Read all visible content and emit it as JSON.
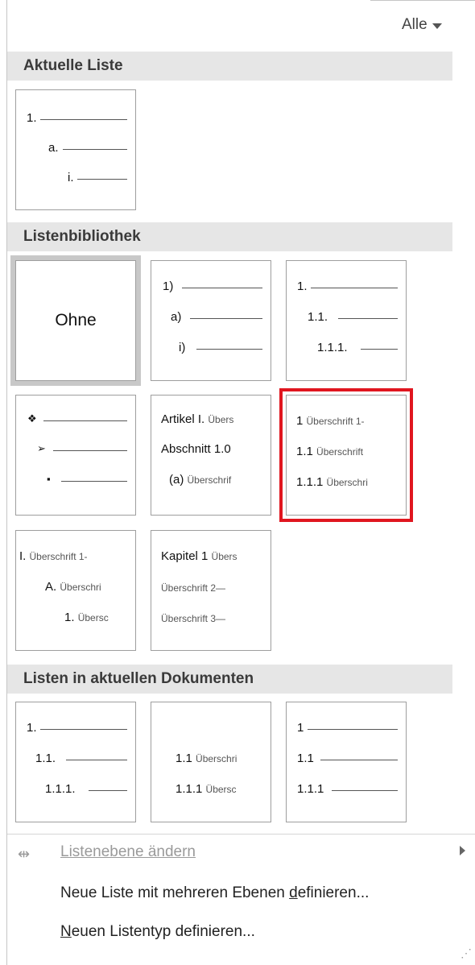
{
  "filter": {
    "label": "Alle"
  },
  "sections": {
    "current": "Aktuelle Liste",
    "library": "Listenbibliothek",
    "documents": "Listen in aktuellen Dokumenten"
  },
  "current_tile": {
    "l1": "1.",
    "l2": "a.",
    "l3": "i."
  },
  "library_tiles": {
    "none": "Ohne",
    "paren": {
      "l1": "1)",
      "l2": "a)",
      "l3": "i)"
    },
    "decimal": {
      "l1": "1.",
      "l2": "1.1.",
      "l3": "1.1.1."
    },
    "bullets": {
      "l1": "❖",
      "l2": "➢",
      "l3": "▪"
    },
    "article": {
      "l1a": "Artikel I.",
      "l1b": "Übers",
      "l2": "Abschnitt 1.0",
      "l3a": "(a)",
      "l3b": "Überschrif"
    },
    "heading_num": {
      "l1a": "1",
      "l1b": "Überschrift 1-",
      "l2a": "1.1",
      "l2b": "Überschrift",
      "l3a": "1.1.1",
      "l3b": "Überschri"
    },
    "roman": {
      "l1a": "I.",
      "l1b": "Überschrift 1-",
      "l2a": "A.",
      "l2b": "Überschri",
      "l3a": "1.",
      "l3b": "Übersc"
    },
    "kapitel": {
      "l1a": "Kapitel 1",
      "l1b": "Übers",
      "l2": "Überschrift 2—",
      "l3": "Überschrift 3—"
    }
  },
  "doc_tiles": {
    "a": {
      "l1": "1.",
      "l2": "1.1.",
      "l3": "1.1.1."
    },
    "b": {
      "l2a": "1.1",
      "l2b": "Überschri",
      "l3a": "1.1.1",
      "l3b": "Übersc"
    },
    "c": {
      "l1": "1",
      "l2": "1.1",
      "l3": "1.1.1"
    }
  },
  "menu": {
    "change_level": "Listenebene ändern",
    "define_multilevel": {
      "pre": "Neue Liste mit mehreren Ebenen ",
      "u": "d",
      "post": "efinieren..."
    },
    "define_style": {
      "u": "N",
      "post": "euen Listentyp definieren..."
    }
  },
  "icons": {
    "change_level": "indent-arrows-icon",
    "submenu": "chevron-right-icon",
    "grip": "resize-grip-icon"
  },
  "colors": {
    "selected_border": "#e0161f",
    "header_bg": "#e6e6e6"
  }
}
